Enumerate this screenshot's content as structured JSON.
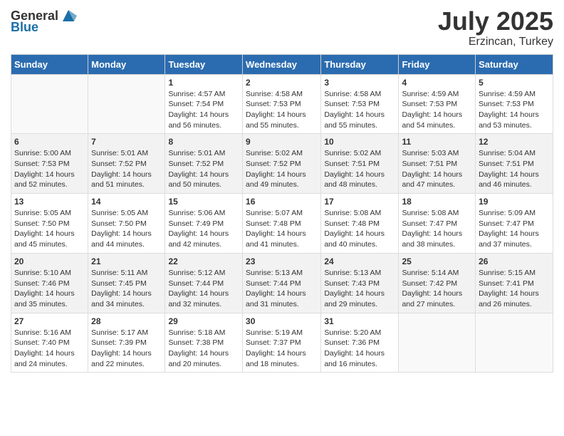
{
  "header": {
    "logo_general": "General",
    "logo_blue": "Blue",
    "month_year": "July 2025",
    "location": "Erzincan, Turkey"
  },
  "weekdays": [
    "Sunday",
    "Monday",
    "Tuesday",
    "Wednesday",
    "Thursday",
    "Friday",
    "Saturday"
  ],
  "weeks": [
    [
      {
        "day": "",
        "info": ""
      },
      {
        "day": "",
        "info": ""
      },
      {
        "day": "1",
        "info": "Sunrise: 4:57 AM\nSunset: 7:54 PM\nDaylight: 14 hours and 56 minutes."
      },
      {
        "day": "2",
        "info": "Sunrise: 4:58 AM\nSunset: 7:53 PM\nDaylight: 14 hours and 55 minutes."
      },
      {
        "day": "3",
        "info": "Sunrise: 4:58 AM\nSunset: 7:53 PM\nDaylight: 14 hours and 55 minutes."
      },
      {
        "day": "4",
        "info": "Sunrise: 4:59 AM\nSunset: 7:53 PM\nDaylight: 14 hours and 54 minutes."
      },
      {
        "day": "5",
        "info": "Sunrise: 4:59 AM\nSunset: 7:53 PM\nDaylight: 14 hours and 53 minutes."
      }
    ],
    [
      {
        "day": "6",
        "info": "Sunrise: 5:00 AM\nSunset: 7:53 PM\nDaylight: 14 hours and 52 minutes."
      },
      {
        "day": "7",
        "info": "Sunrise: 5:01 AM\nSunset: 7:52 PM\nDaylight: 14 hours and 51 minutes."
      },
      {
        "day": "8",
        "info": "Sunrise: 5:01 AM\nSunset: 7:52 PM\nDaylight: 14 hours and 50 minutes."
      },
      {
        "day": "9",
        "info": "Sunrise: 5:02 AM\nSunset: 7:52 PM\nDaylight: 14 hours and 49 minutes."
      },
      {
        "day": "10",
        "info": "Sunrise: 5:02 AM\nSunset: 7:51 PM\nDaylight: 14 hours and 48 minutes."
      },
      {
        "day": "11",
        "info": "Sunrise: 5:03 AM\nSunset: 7:51 PM\nDaylight: 14 hours and 47 minutes."
      },
      {
        "day": "12",
        "info": "Sunrise: 5:04 AM\nSunset: 7:51 PM\nDaylight: 14 hours and 46 minutes."
      }
    ],
    [
      {
        "day": "13",
        "info": "Sunrise: 5:05 AM\nSunset: 7:50 PM\nDaylight: 14 hours and 45 minutes."
      },
      {
        "day": "14",
        "info": "Sunrise: 5:05 AM\nSunset: 7:50 PM\nDaylight: 14 hours and 44 minutes."
      },
      {
        "day": "15",
        "info": "Sunrise: 5:06 AM\nSunset: 7:49 PM\nDaylight: 14 hours and 42 minutes."
      },
      {
        "day": "16",
        "info": "Sunrise: 5:07 AM\nSunset: 7:48 PM\nDaylight: 14 hours and 41 minutes."
      },
      {
        "day": "17",
        "info": "Sunrise: 5:08 AM\nSunset: 7:48 PM\nDaylight: 14 hours and 40 minutes."
      },
      {
        "day": "18",
        "info": "Sunrise: 5:08 AM\nSunset: 7:47 PM\nDaylight: 14 hours and 38 minutes."
      },
      {
        "day": "19",
        "info": "Sunrise: 5:09 AM\nSunset: 7:47 PM\nDaylight: 14 hours and 37 minutes."
      }
    ],
    [
      {
        "day": "20",
        "info": "Sunrise: 5:10 AM\nSunset: 7:46 PM\nDaylight: 14 hours and 35 minutes."
      },
      {
        "day": "21",
        "info": "Sunrise: 5:11 AM\nSunset: 7:45 PM\nDaylight: 14 hours and 34 minutes."
      },
      {
        "day": "22",
        "info": "Sunrise: 5:12 AM\nSunset: 7:44 PM\nDaylight: 14 hours and 32 minutes."
      },
      {
        "day": "23",
        "info": "Sunrise: 5:13 AM\nSunset: 7:44 PM\nDaylight: 14 hours and 31 minutes."
      },
      {
        "day": "24",
        "info": "Sunrise: 5:13 AM\nSunset: 7:43 PM\nDaylight: 14 hours and 29 minutes."
      },
      {
        "day": "25",
        "info": "Sunrise: 5:14 AM\nSunset: 7:42 PM\nDaylight: 14 hours and 27 minutes."
      },
      {
        "day": "26",
        "info": "Sunrise: 5:15 AM\nSunset: 7:41 PM\nDaylight: 14 hours and 26 minutes."
      }
    ],
    [
      {
        "day": "27",
        "info": "Sunrise: 5:16 AM\nSunset: 7:40 PM\nDaylight: 14 hours and 24 minutes."
      },
      {
        "day": "28",
        "info": "Sunrise: 5:17 AM\nSunset: 7:39 PM\nDaylight: 14 hours and 22 minutes."
      },
      {
        "day": "29",
        "info": "Sunrise: 5:18 AM\nSunset: 7:38 PM\nDaylight: 14 hours and 20 minutes."
      },
      {
        "day": "30",
        "info": "Sunrise: 5:19 AM\nSunset: 7:37 PM\nDaylight: 14 hours and 18 minutes."
      },
      {
        "day": "31",
        "info": "Sunrise: 5:20 AM\nSunset: 7:36 PM\nDaylight: 14 hours and 16 minutes."
      },
      {
        "day": "",
        "info": ""
      },
      {
        "day": "",
        "info": ""
      }
    ]
  ]
}
